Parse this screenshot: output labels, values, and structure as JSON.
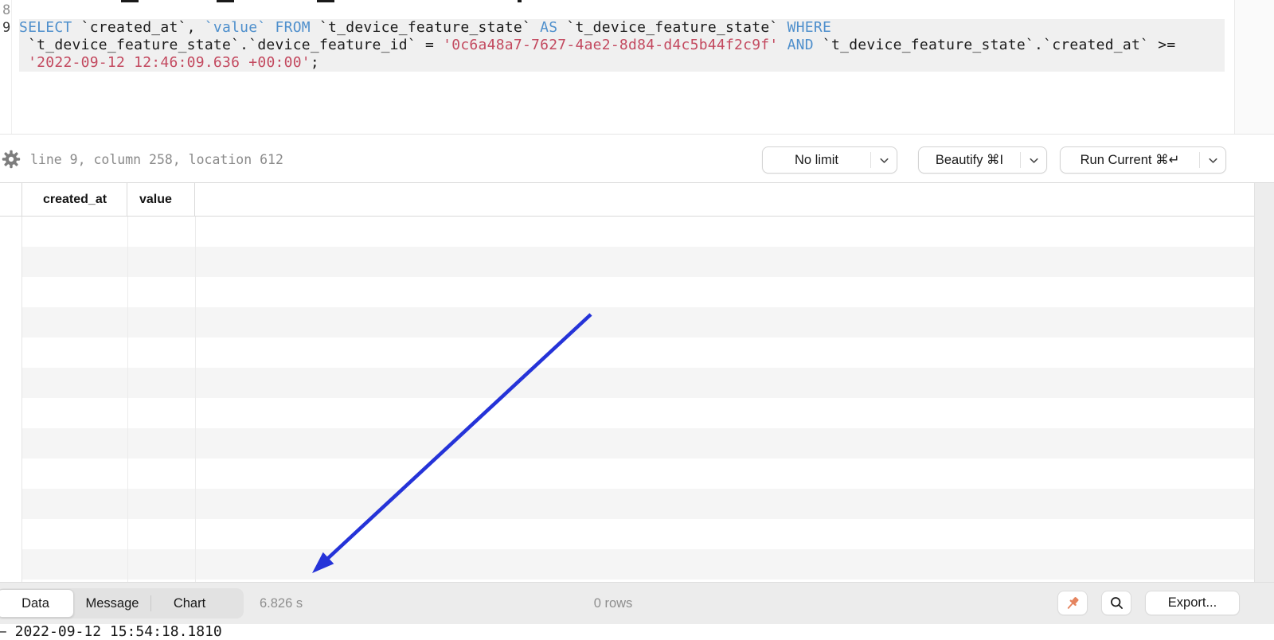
{
  "colors": {
    "keyword": "#4e8fcc",
    "string": "#c3495f",
    "code_text": "#1b1b1b",
    "arrow": "#2533d8",
    "pin": "#e5845f"
  },
  "editor": {
    "line_numbers": [
      "8",
      "9"
    ],
    "code_lines": [
      [
        {
          "t": "kw",
          "x": "SELECT "
        },
        {
          "t": "id",
          "x": "`created_at`, "
        },
        {
          "t": "kw",
          "x": "`value`"
        },
        {
          "t": "id",
          "x": " "
        },
        {
          "t": "kw",
          "x": "FROM "
        },
        {
          "t": "id",
          "x": "`t_device_feature_state` "
        },
        {
          "t": "kw",
          "x": "AS "
        },
        {
          "t": "id",
          "x": "`t_device_feature_state` "
        },
        {
          "t": "kw",
          "x": "WHERE"
        }
      ],
      [
        {
          "t": "id",
          "x": " `t_device_feature_state`.`device_feature_id` = "
        },
        {
          "t": "str",
          "x": "'0c6a48a7-7627-4ae2-8d84-d4c5b44f2c9f'"
        },
        {
          "t": "id",
          "x": " "
        },
        {
          "t": "kw",
          "x": "AND"
        },
        {
          "t": "id",
          "x": " `t_device_feature_state`.`created_at` >="
        }
      ],
      [
        {
          "t": "id",
          "x": " "
        },
        {
          "t": "str",
          "x": "'2022-09-12 12:46:09.636 +00:00'"
        },
        {
          "t": "id",
          "x": ";"
        }
      ]
    ]
  },
  "status_bar": {
    "cursor_info": "line 9, column 258, location 612"
  },
  "toolbar": {
    "limit_button": "No limit",
    "beautify_button": "Beautify ⌘I",
    "run_button": "Run Current ⌘↵"
  },
  "table": {
    "columns": [
      "created_at",
      "value"
    ],
    "rows": [],
    "visible_empty_rows": 13
  },
  "bottom_bar": {
    "tabs": [
      {
        "label": "Data",
        "active": true
      },
      {
        "label": "Message",
        "active": false
      },
      {
        "label": "Chart",
        "active": false
      }
    ],
    "elapsed": "6.826 s",
    "row_count": "0 rows",
    "export_button": "Export..."
  },
  "log_line": "– 2022-09-12 15:54:18.1810"
}
